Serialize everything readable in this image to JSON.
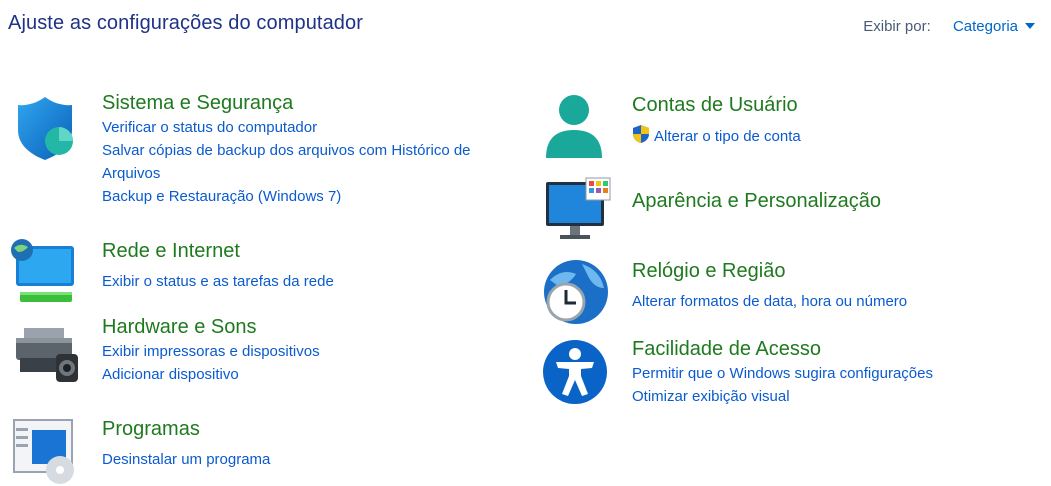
{
  "header": {
    "title": "Ajuste as configurações do computador",
    "view_by_label": "Exibir por:",
    "view_by_value": "Categoria"
  },
  "categories": {
    "system": {
      "title": "Sistema e Segurança",
      "links": [
        "Verificar o status do computador",
        "Salvar cópias de backup dos arquivos com Histórico de Arquivos",
        "Backup e Restauração (Windows 7)"
      ]
    },
    "network": {
      "title": "Rede e Internet",
      "links": [
        "Exibir o status e as tarefas da rede"
      ]
    },
    "hardware": {
      "title": "Hardware e Sons",
      "links": [
        "Exibir impressoras e dispositivos",
        "Adicionar dispositivo"
      ]
    },
    "programs": {
      "title": "Programas",
      "links": [
        "Desinstalar um programa"
      ]
    },
    "accounts": {
      "title": "Contas de Usuário",
      "links": [
        "Alterar o tipo de conta"
      ]
    },
    "appearance": {
      "title": "Aparência e Personalização",
      "links": []
    },
    "clock": {
      "title": "Relógio e Região",
      "links": [
        "Alterar formatos de data, hora ou número"
      ]
    },
    "access": {
      "title": "Facilidade de Acesso",
      "links": [
        "Permitir que o Windows sugira configurações",
        "Otimizar exibição visual"
      ]
    }
  },
  "colors": {
    "title_blue": "#1e3287",
    "category_green": "#1f7a1f",
    "link_blue": "#0a5bd0"
  },
  "icons": {
    "system": "shield-icon",
    "network": "network-monitor-icon",
    "hardware": "printer-icon",
    "programs": "programs-icon",
    "accounts": "user-icon",
    "appearance": "monitor-icon",
    "clock": "clock-globe-icon",
    "access": "accessibility-icon",
    "uac": "uac-shield-icon"
  }
}
